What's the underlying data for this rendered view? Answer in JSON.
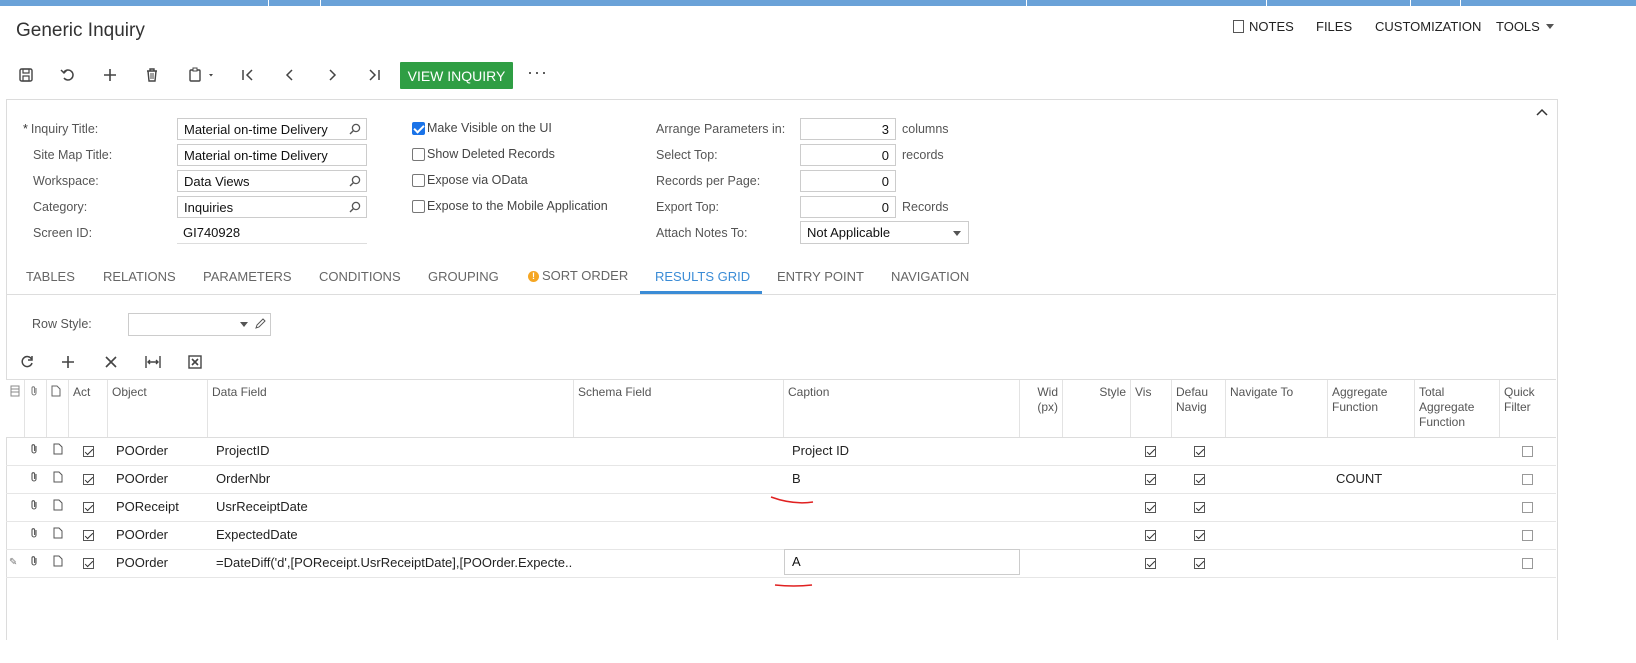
{
  "header": {
    "title": "Generic Inquiry",
    "menu": {
      "notes": "NOTES",
      "files": "FILES",
      "customization": "CUSTOMIZATION",
      "tools": "TOOLS"
    }
  },
  "toolbar": {
    "icons": [
      "save-icon",
      "undo-icon",
      "add-icon",
      "delete-icon",
      "copy-paste-icon",
      "first-icon",
      "previous-icon",
      "next-icon",
      "last-icon"
    ],
    "view_inquiry": "VIEW INQUIRY",
    "more": "···"
  },
  "form": {
    "required_mark": "*",
    "inquiry_title_label": "Inquiry Title:",
    "inquiry_title_value": "Material on-time Delivery",
    "site_map_title_label": "Site Map Title:",
    "site_map_title_value": "Material on-time Delivery",
    "workspace_label": "Workspace:",
    "workspace_value": "Data Views",
    "category_label": "Category:",
    "category_value": "Inquiries",
    "screen_id_label": "Screen ID:",
    "screen_id_value": "GI740928",
    "make_visible": {
      "label": "Make Visible on the UI",
      "checked": true
    },
    "show_deleted": {
      "label": "Show Deleted Records",
      "checked": false
    },
    "expose_odata": {
      "label": "Expose via OData",
      "checked": false
    },
    "expose_mobile": {
      "label": "Expose to the Mobile Application",
      "checked": false
    },
    "arrange_params_label": "Arrange Parameters in:",
    "arrange_params_value": "3",
    "arrange_params_unit": "columns",
    "select_top_label": "Select Top:",
    "select_top_value": "0",
    "select_top_unit": "records",
    "records_per_page_label": "Records per Page:",
    "records_per_page_value": "0",
    "export_top_label": "Export Top:",
    "export_top_value": "0",
    "export_top_unit": "Records",
    "attach_notes_label": "Attach Notes To:",
    "attach_notes_value": "Not Applicable"
  },
  "tabs": [
    "TABLES",
    "RELATIONS",
    "PARAMETERS",
    "CONDITIONS",
    "GROUPING",
    "SORT ORDER",
    "RESULTS GRID",
    "ENTRY POINT",
    "NAVIGATION"
  ],
  "active_tab": "RESULTS GRID",
  "results_grid": {
    "row_style_label": "Row Style:",
    "row_style_value": "",
    "tool_icons": [
      "refresh-icon",
      "add-row-icon",
      "delete-row-icon",
      "fit-columns-icon",
      "export-excel-icon"
    ],
    "columns": {
      "active": "Act",
      "object": "Object",
      "data_field": "Data Field",
      "schema_field": "Schema Field",
      "caption": "Caption",
      "width": "Wid (px)",
      "style": "Style",
      "visible": "Vis",
      "default_nav": "Defau Navig",
      "navigate_to": "Navigate To",
      "aggregate_function": "Aggregate Function",
      "total_aggregate_function": "Total Aggregate Function",
      "quick_filter": "Quick Filter"
    },
    "rows": [
      {
        "active": true,
        "object": "POOrder",
        "data_field": "ProjectID",
        "caption": "Project ID",
        "visible": true,
        "default_nav": true,
        "aggregate": "",
        "quick_filter": false
      },
      {
        "active": true,
        "object": "POOrder",
        "data_field": "OrderNbr",
        "caption": "B",
        "visible": true,
        "default_nav": true,
        "aggregate": "COUNT",
        "quick_filter": false
      },
      {
        "active": true,
        "object": "POReceipt",
        "data_field": "UsrReceiptDate",
        "caption": "",
        "visible": true,
        "default_nav": true,
        "aggregate": "",
        "quick_filter": false
      },
      {
        "active": true,
        "object": "POOrder",
        "data_field": "ExpectedDate",
        "caption": "",
        "visible": true,
        "default_nav": true,
        "aggregate": "",
        "quick_filter": false
      },
      {
        "active": true,
        "object": "POOrder",
        "data_field": "=DateDiff('d',[POReceipt.UsrReceiptDate],[POOrder.Expecte...",
        "caption": "A",
        "visible": true,
        "default_nav": true,
        "aggregate": "",
        "quick_filter": false
      }
    ]
  },
  "colors": {
    "accent": "#3b8cd6",
    "primary_button": "#2f9e44",
    "top_bar": "#6aa2d8",
    "annotation": "#e02020"
  }
}
